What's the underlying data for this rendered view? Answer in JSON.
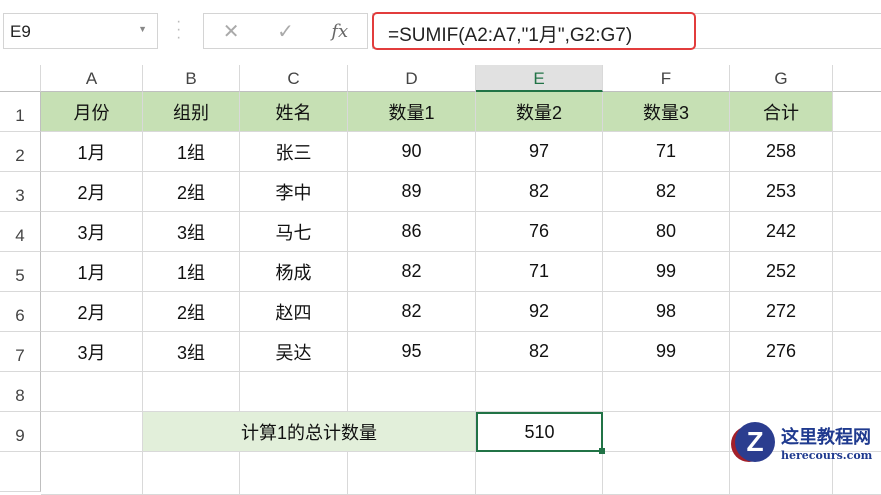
{
  "name_box": "E9",
  "formula": "=SUMIF(A2:A7,\"1月\",G2:G7)",
  "icons": {
    "cancel": "✕",
    "enter": "✓",
    "fx": "fx"
  },
  "columns": [
    "A",
    "B",
    "C",
    "D",
    "E",
    "F",
    "G",
    ""
  ],
  "rows": [
    "1",
    "2",
    "3",
    "4",
    "5",
    "6",
    "7",
    "8",
    "9"
  ],
  "table": {
    "header": [
      "月份",
      "组别",
      "姓名",
      "数量1",
      "数量2",
      "数量3",
      "合计"
    ],
    "rows": [
      [
        "1月",
        "1组",
        "张三",
        "90",
        "97",
        "71",
        "258"
      ],
      [
        "2月",
        "2组",
        "李中",
        "89",
        "82",
        "82",
        "253"
      ],
      [
        "3月",
        "3组",
        "马七",
        "86",
        "76",
        "80",
        "242"
      ],
      [
        "1月",
        "1组",
        "杨成",
        "82",
        "71",
        "99",
        "252"
      ],
      [
        "2月",
        "2组",
        "赵四",
        "82",
        "92",
        "98",
        "272"
      ],
      [
        "3月",
        "3组",
        "吴达",
        "95",
        "82",
        "99",
        "276"
      ]
    ]
  },
  "summary": {
    "label": "计算1的总计数量",
    "value": "510"
  },
  "watermark": {
    "title": "这里教程网",
    "url": "herecours.com"
  }
}
